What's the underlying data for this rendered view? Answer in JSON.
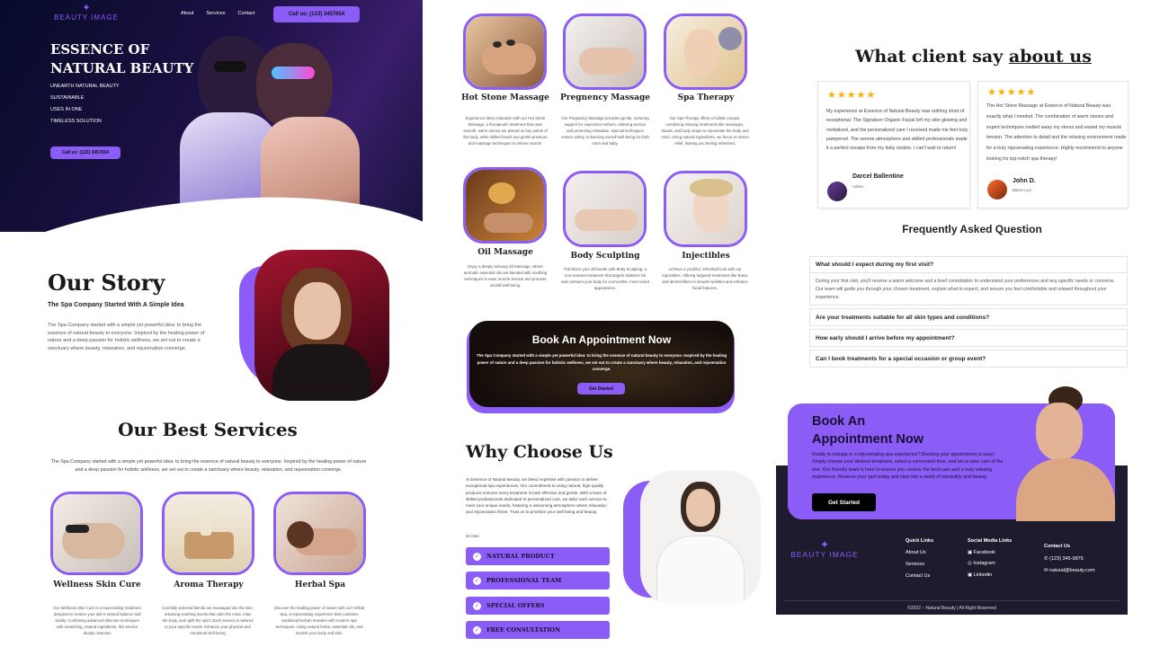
{
  "brand": {
    "name": "BEAUTY IMAGE"
  },
  "nav": {
    "items": [
      "About",
      "Services",
      "Contact"
    ],
    "call_button": "Call us: (123) 3457654"
  },
  "hero": {
    "title_line1": "ESSENCE OF",
    "title_line2": "NATURAL BEAUTY",
    "tags": [
      "UNEARTH NATURAL BEAUTY",
      "SUSTAINABLE",
      "USES IN ONE",
      "TIMELESS SOLUTION"
    ],
    "call_button": "Call us: (123) 3457654"
  },
  "story": {
    "title": "Our Story",
    "subtitle": "The Spa Company Started With A Simple Idea",
    "body": "The Spa Company started with a simple yet powerful idea: to bring the essence of natural beauty to everyone. Inspired by the healing power of nature and a deep passion for holistic wellness, we set out to create a sanctuary where beauty, relaxation, and rejuvenation converge."
  },
  "best": {
    "title": "Our Best Services",
    "body": "The Spa Company started with a simple yet powerful idea: to bring the essence of natural beauty to everyone. Inspired by the healing power of nature and a deep passion for holistic wellness, we set out to create a sanctuary where beauty, relaxation, and rejuvenation converge.",
    "services": [
      {
        "title": "Wellness Skin Cure",
        "desc": "Our Wellness Skin Cure is a rejuvenating treatment designed to restore your skin's natural balance and vitality. Combining advanced skincare techniques with nourishing, natural ingredients, this service deeply cleanses"
      },
      {
        "title": "Aroma Therapy",
        "desc": "Carefully selected blends are massaged into the skin, releasing soothing scents that calm the mind, relax the body, and uplift the spirit. Each session is tailored to your specific needs. Enhance your physical and emotional well-being"
      },
      {
        "title": "Herbal Spa",
        "desc": "Discover the healing power of nature with our Herbal Spa, a rejuvenating experience that combines traditional herbal remedies with modern spa techniques. Using natural herbs, essential oils, and nourish your body and skin."
      }
    ]
  },
  "services_grid": [
    {
      "title": "Hot Stone Massage",
      "desc": "Experience deep relaxation with our Hot Stone Massage, a therapeutic treatment that uses smooth, warm stones are placed on key points of the body, while skilled hands use gentle pressure and massage techniques to relieve muscle."
    },
    {
      "title": "Pregnency Massage",
      "desc": "Our Pregnancy Massage provides gentle, nurturing support for expectant mothers, relieving tension and promoting relaxation. Special techniques ensure safety, enhancing overall well-being for both mom and baby."
    },
    {
      "title": "Spa Therapy",
      "desc": "Our Spa Therapy offers a holistic escape, combining relaxing treatments like massages, facials, and body wraps to rejuvenate the body and mind. Using natural ingredients, we focus on stress relief, leaving you feeling refreshed."
    },
    {
      "title": "Oil Massage",
      "desc": "Enjoy a deeply relaxing Oil Massage, where aromatic essential oils are blended with soothing techniques to ease muscle tension and promote overall well-being."
    },
    {
      "title": "Body Sculpting",
      "desc": "Transform your silhouette with Body Sculpting, a non-invasive treatment that targets stubborn fat and contours your body for a smoother, more toned appearance."
    },
    {
      "title": "Injectibles",
      "desc": "Achieve a youthful, refreshed look with our injectables, offering targeted treatments like Botox and dermal fillers to smooth wrinkles and enhance facial features."
    }
  ],
  "appt_dark": {
    "title": "Book An Appointment Now",
    "body": "The Spa Company started with a simple yet powerful idea: to bring the essence of natural beauty to everyone. Inspired by the healing power of nature and a deep passion for holistic wellness, we set out to create a sanctuary where beauty, relaxation, and rejuvenation converge.",
    "button": "Get Started"
  },
  "why": {
    "title": "Why Choose Us",
    "body": "At Essence of Natural Beauty, we blend expertise with passion to deliver exceptional spa experiences. Our commitment to using natural, high-quality products ensures every treatment is both effective and gentle. With a team of skilled professionals dedicated to personalized care, we tailor each service to meet your unique needs, fostering a welcoming atmosphere where relaxation and rejuvenation thrive. Trust us to prioritize your well-being and beauty.",
    "extra": "4s mini",
    "items": [
      "NATURAL PRODUCT",
      "PROFESSIONAL TEAM",
      "SPECIAL OFFERS",
      "FREE CONSULTATION"
    ]
  },
  "testimonials": {
    "title_plain": "What client say",
    "title_underline": "about us",
    "stars": "★★★★★",
    "items": [
      {
        "text": "My experience at Essence of Natural Beauty was nothing short of exceptional. The Signature Organic Facial left my skin glowing and revitalized, and the personalized care I received made me feel truly pampered. The serene atmosphere and skilled professionals made it a perfect escape from my daily routine. I can't wait to return!",
        "name": "Darcel Ballentine",
        "role": "Admin"
      },
      {
        "text": "The Hot Stone Massage at Essence of Natural Beauty was exactly what I needed. The combination of warm stones and expert techniques melted away my stress and eased my muscle tension. The attention to detail and the relaxing environment made for a truly rejuvenating experience. Highly recommend to anyone looking for top-notch spa therapy!",
        "name": "John D.",
        "role": "Baron LLC."
      }
    ]
  },
  "faq": {
    "title": "Frequently Asked Question",
    "items": [
      {
        "q": "What should I expect during my first visit?",
        "a": "During your first visit, you'll receive a warm welcome and a brief consultation to understand your preferences and any specific needs or concerns. Our team will guide you through your chosen treatment, explain what to expect, and ensure you feel comfortable and relaxed throughout your experience."
      },
      {
        "q": "Are your treatments suitable for all skin types and conditions?"
      },
      {
        "q": "How early should I arrive before my appointment?"
      },
      {
        "q": "Can I book treatments for a special occasion or group event?"
      }
    ]
  },
  "appt_purple": {
    "title_line1": "Book An",
    "title_line2": "Appointment Now",
    "body": "Ready to indulge in a rejuvenating spa experience? Booking your appointment is easy! Simply choose your desired treatment, select a convenient time, and let us take care of the rest. Our friendly team is here to ensure you receive the best care and a truly relaxing experience. Reserve your spot today and step into a world of tranquility and beauty.",
    "button": "Get Started"
  },
  "footer": {
    "quick_title": "Quick Links",
    "quick": [
      "About Us",
      "Services",
      "Contact Us"
    ],
    "social_title": "Social Media Links",
    "social": [
      "Facebook",
      "Instagram",
      "Linkedin"
    ],
    "contact_title": "Contact Us",
    "phone": "(123) 345-9876",
    "email": "natural@beauty.com",
    "copyright": "©2022 – Natural Beauty | All Right Reserved"
  },
  "colors": {
    "accent": "#8b5cf6",
    "dark": "#1e1b2e"
  }
}
